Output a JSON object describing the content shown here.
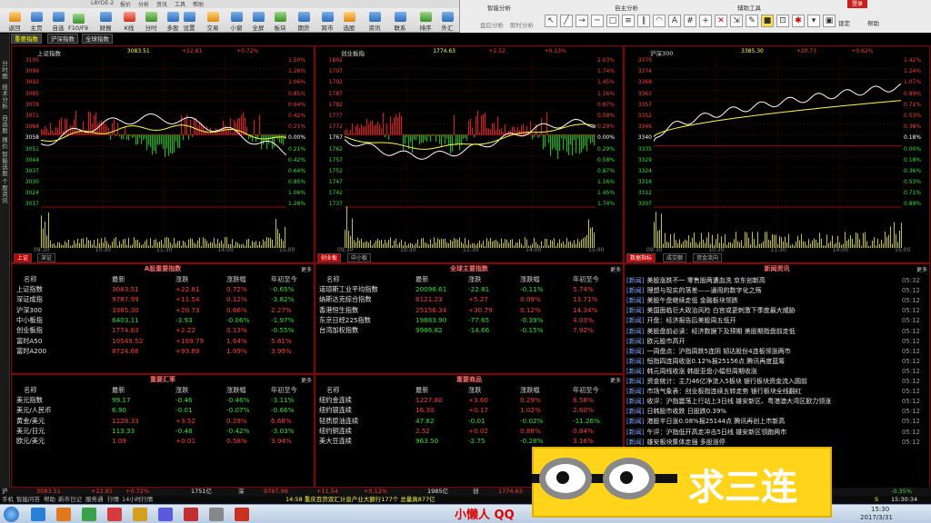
{
  "appbar": {
    "text": "L8YDE-2",
    "menu": [
      "报价",
      "分析",
      "资讯",
      "工具",
      "帮助"
    ]
  },
  "toolbar": {
    "buttons": [
      "返回",
      "主页",
      "自选",
      "F10/F9",
      "财报",
      "K线",
      "分时",
      "多股",
      "设置",
      "交易",
      "小窗",
      "全屏",
      "板块",
      "期货",
      "跨市",
      "选股",
      "资讯",
      "联系",
      "排序",
      "外汇"
    ]
  },
  "dock": {
    "title1": "智能分析",
    "title2": "自主分析",
    "title3": "辅助工具",
    "left_tab": "盘后分析",
    "mid_tab": "即时分析",
    "right_tag": "登录",
    "tools": [
      "大盘",
      "自选",
      "资讯",
      "帮助"
    ]
  },
  "tabs": [
    "重要指数",
    "沪深指数",
    "全球指数"
  ],
  "leftnav": [
    "分时图",
    "技术分析",
    "自选股",
    "报价",
    "智能选股",
    "个股资讯"
  ],
  "panels": [
    {
      "title": "上证指数",
      "v1": "3083.51",
      "v2": "+22.81",
      "v3": "+0.72%",
      "left_axis": [
        "3105",
        "3099",
        "3092",
        "3085",
        "3078",
        "3071",
        "3064",
        "3058",
        "3051",
        "3044",
        "3037",
        "3030",
        "3024",
        "3017"
      ],
      "right_axis": [
        "1.50%",
        "1.28%",
        "1.06%",
        "0.85%",
        "0.64%",
        "0.42%",
        "0.21%",
        "0.00%",
        "0.21%",
        "0.42%",
        "0.64%",
        "0.85%",
        "1.06%",
        "1.28%"
      ],
      "x_ticks": [
        "09:30",
        "10:30",
        "11:30",
        "14:00",
        "15:00"
      ],
      "bottom_tabs": [
        "上证",
        "深证"
      ]
    },
    {
      "title": "创业板指",
      "v1": "1774.63",
      "v2": "+2.22",
      "v3": "+0.13%",
      "left_axis": [
        "1802",
        "1797",
        "1792",
        "1787",
        "1782",
        "1777",
        "1772",
        "1767",
        "1762",
        "1757",
        "1752",
        "1747",
        "1742",
        "1737"
      ],
      "right_axis": [
        "2.03%",
        "1.74%",
        "1.45%",
        "1.16%",
        "0.87%",
        "0.58%",
        "0.29%",
        "0.00%",
        "0.29%",
        "0.58%",
        "0.87%",
        "1.16%",
        "1.45%",
        "1.74%"
      ],
      "x_ticks": [
        "09:30",
        "10:30",
        "11:30",
        "14:00",
        "15:00"
      ],
      "bottom_tabs": [
        "创业板",
        "中小板"
      ]
    },
    {
      "title": "沪深300",
      "v1": "3385.30",
      "v2": "+20.73",
      "v3": "+0.62%",
      "left_axis": [
        "3379",
        "3374",
        "3368",
        "3363",
        "3357",
        "3352",
        "3346",
        "3340",
        "3335",
        "3329",
        "3324",
        "3318",
        "3312",
        "3307"
      ],
      "right_axis": [
        "1.42%",
        "1.24%",
        "1.07%",
        "0.89%",
        "0.71%",
        "0.53%",
        "0.36%",
        "0.18%",
        "0.00%",
        "0.18%",
        "0.36%",
        "0.53%",
        "0.71%",
        "0.89%"
      ],
      "x_ticks": [
        "09:30",
        "10:30",
        "11:30",
        "14:00",
        "15:00"
      ],
      "bottom_tabs": [
        "数据指标",
        "成交额",
        "资金流向"
      ]
    }
  ],
  "a_shares": {
    "title": "A股重要指数",
    "more": "更多",
    "headers": [
      "名称",
      "最新",
      "涨跌",
      "涨跌幅",
      "年初至今"
    ],
    "rows": [
      [
        "上证指数",
        "3083.51",
        "+22.81",
        "0.72%",
        "-0.65%"
      ],
      [
        "深证成指",
        "9787.99",
        "+11.54",
        "0.12%",
        "-3.82%"
      ],
      [
        "沪深300",
        "3385.30",
        "+20.73",
        "0.66%",
        "2.27%"
      ],
      [
        "中小板指",
        "6403.11",
        "-3.93",
        "-0.06%",
        "-1.97%"
      ],
      [
        "创业板指",
        "1774.63",
        "+2.22",
        "0.13%",
        "-0.55%"
      ],
      [
        "富时A50",
        "10549.52",
        "+169.79",
        "1.64%",
        "5.81%"
      ],
      [
        "富时A200",
        "8724.68",
        "+93.89",
        "1.09%",
        "3.99%"
      ]
    ]
  },
  "global": {
    "title": "全球主要指数",
    "more": "更多",
    "headers": [
      "名称",
      "最新",
      "涨跌",
      "涨跌幅",
      "年初至今"
    ],
    "rows": [
      [
        "道琼斯工业平均指数",
        "20096.61",
        "-22.81",
        "-0.11%",
        "5.74%"
      ],
      [
        "纳斯达克综合指数",
        "6121.23",
        "+5.27",
        "0.09%",
        "13.71%"
      ],
      [
        "香港恒生指数",
        "25156.34",
        "+30.79",
        "0.12%",
        "14.34%"
      ],
      [
        "东京日经225指数",
        "19883.90",
        "-77.65",
        "-0.39%",
        "4.03%"
      ],
      [
        "台湾加权指数",
        "9986.82",
        "-14.66",
        "-0.15%",
        "7.92%"
      ]
    ]
  },
  "fx": {
    "title": "重要汇率",
    "more": "更多",
    "headers": [
      "名称",
      "最新",
      "涨跌",
      "涨跌幅",
      "年初至今"
    ],
    "rows": [
      [
        "美元指数",
        "99.17",
        "-0.46",
        "-0.46%",
        "-3.11%"
      ],
      [
        "美元/人民币",
        "6.90",
        "-0.01",
        "-0.07%",
        "-0.66%"
      ],
      [
        "黄金/美元",
        "1228.33",
        "+3.52",
        "0.29%",
        "6.68%"
      ],
      [
        "美元/日元",
        "113.33",
        "-0.48",
        "-0.42%",
        "-3.03%"
      ],
      [
        "欧元/美元",
        "1.09",
        "+0.01",
        "0.58%",
        "3.94%"
      ]
    ]
  },
  "commodities": {
    "title": "重要商品",
    "more": "更多",
    "headers": [
      "名称",
      "最新",
      "涨跌",
      "涨跌幅",
      "年初至今"
    ],
    "rows": [
      [
        "纽约金连续",
        "1227.80",
        "+3.60",
        "0.29%",
        "6.58%"
      ],
      [
        "纽约银连续",
        "16.30",
        "+0.17",
        "1.02%",
        "2.60%"
      ],
      [
        "轻质原油连续",
        "47.82",
        "-0.01",
        "-0.02%",
        "-11.26%"
      ],
      [
        "纽约铜连续",
        "2.52",
        "+0.02",
        "0.88%",
        "0.84%"
      ],
      [
        "美大豆连续",
        "963.50",
        "-2.75",
        "-0.28%",
        "3.16%"
      ]
    ]
  },
  "news": {
    "title": "新闻资讯",
    "more": "更多",
    "tag": "[新闻]",
    "items": [
      [
        "美股涨跌不一 零售股两遭血洗 京东创新高",
        "05:32"
      ],
      [
        "理想与现实的落差——通用的数字化之殇",
        "05:12"
      ],
      [
        "美股午盘继续走低 金融板块领跌",
        "05:12"
      ],
      [
        "美国面临巨大政治风险 白宫或更刺激下季度最大威胁",
        "05:12"
      ],
      [
        "开盘：经济报告后美股周五低开",
        "05:12"
      ],
      [
        "美股盘前必读：经济数据下及预期 美股期指盘前走低",
        "05:12"
      ],
      [
        "欧元股市高开",
        "05:12"
      ],
      [
        "一周盘点：沪指周跌5连阴 韧达股份4连板领涨两市",
        "05:12"
      ],
      [
        "恒指四连周收涨0.12%报25156点 腾讯再度蓝筹",
        "05:12"
      ],
      [
        "韩元周线收涨 韩股亚盘小幅但周期收涨",
        "05:12"
      ],
      [
        "资金统计：主力46亿净流入5板块 银行板块资金流入圆前",
        "05:12"
      ],
      [
        "市场气象表：创业板指连续五转走势 银行板块全线翻红",
        "05:12"
      ],
      [
        "收评：沪指震荡上行站上3日线 雄安新区、粤港澳大湾区掀力领涨",
        "05:12"
      ],
      [
        "日韩股市收跌 日股跌0.39%",
        "05:12"
      ],
      [
        "港股半日涨0.08%报25144点 腾讯再创上市新高",
        "05:12"
      ],
      [
        "午评：沪指低开高走冲击5日线 雄安新区领跑两市",
        "05:12"
      ],
      [
        "雄安板块集体走强 多股涨停",
        "05:12"
      ]
    ]
  },
  "statusbar": {
    "sh": "沪",
    "sh_v": "3083.51",
    "sh_c": "+22.81",
    "sh_p": "+0.72%",
    "sh_amt": "1751亿",
    "sz": "深",
    "sz_v": "9787.99",
    "sz_c": "+11.54",
    "sz_p": "+0.12%",
    "sz_amt": "1985亿",
    "cy": "创",
    "cy_v": "1774.63",
    "right_p": "-0.35%",
    "right_s": "S",
    "time": "15:30:34"
  },
  "statusbar2": {
    "items": [
      "手机",
      "智能问答",
      "帮助",
      "新市日记",
      "服务通",
      "行情",
      "14小时行情"
    ],
    "ticker": "14:58 重庆百货双汇计息户业大额行177个 总量真877亿"
  },
  "overlay": {
    "text": "求三连",
    "watermark": "小懒人 QQ"
  },
  "taskbar": {
    "time": "15:30",
    "date": "2017/3/31"
  }
}
